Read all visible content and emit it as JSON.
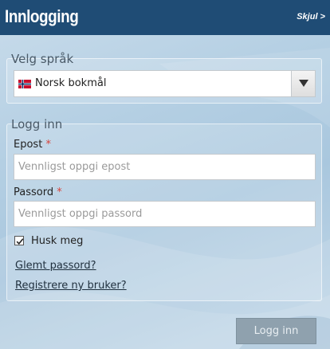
{
  "header": {
    "title": "Innlogging",
    "hide_label": "Skjul >"
  },
  "language": {
    "legend": "Velg språk",
    "selected": "Norsk bokmål",
    "flag_icon": "norway-flag-icon"
  },
  "login": {
    "legend": "Logg inn",
    "email_label": "Epost",
    "email_required": "*",
    "email_placeholder": "Vennligst oppgi epost",
    "password_label": "Passord",
    "password_required": "*",
    "password_placeholder": "Vennligst oppgi passord",
    "remember_label": "Husk meg",
    "remember_checked": true,
    "forgot_link": "Glemt passord?",
    "register_link": "Registrere ny bruker?",
    "submit_label": "Logg inn"
  },
  "colors": {
    "header_bg": "#1f4c75",
    "required": "#d9433b",
    "button_bg": "#8fa1ae"
  }
}
